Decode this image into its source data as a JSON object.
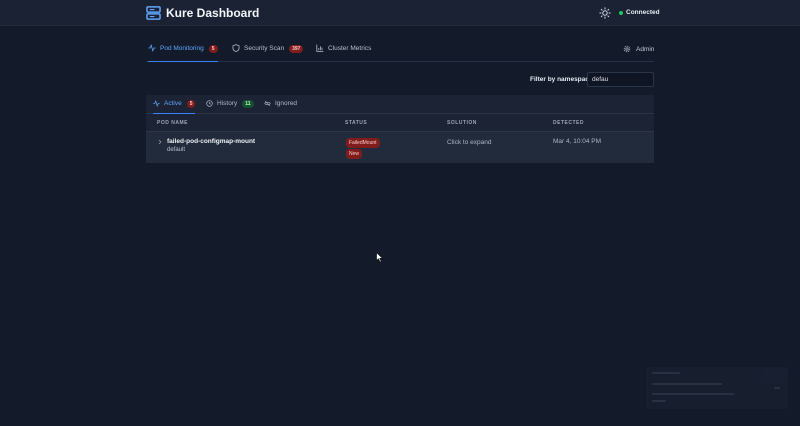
{
  "app": {
    "title": "Kure Dashboard",
    "connection_status": "Connected",
    "status_color": "#22c55e",
    "accent": "#3b82f6"
  },
  "header": {
    "theme_icon": "sun-icon",
    "logo_icon": "server-stack-icon"
  },
  "main_tabs": [
    {
      "label": "Pod Monitoring",
      "count": "5",
      "icon": "activity-icon",
      "active": true
    },
    {
      "label": "Security Scan",
      "count": "397",
      "icon": "shield-icon",
      "active": false
    },
    {
      "label": "Cluster Metrics",
      "icon": "bar-chart-icon",
      "active": false
    }
  ],
  "admin": {
    "label": "Admin",
    "icon": "gear-icon"
  },
  "filter": {
    "label": "Filter by namespace:",
    "value": "defau"
  },
  "sub_tabs": [
    {
      "label": "Active",
      "count": "5",
      "icon": "activity-icon",
      "active": true
    },
    {
      "label": "History",
      "count": "11",
      "icon": "clock-icon",
      "active": false
    },
    {
      "label": "Ignored",
      "icon": "eye-off-icon",
      "active": false
    }
  ],
  "table": {
    "columns": [
      "POD NAME",
      "STATUS",
      "SOLUTION",
      "DETECTED"
    ],
    "rows": [
      {
        "pod_name": "failed-pod-configmap-mount",
        "namespace": "default",
        "status": [
          "FailedMount",
          "New"
        ],
        "solution": "Click to expand",
        "detected": "Mar 4, 10:04 PM"
      }
    ]
  }
}
